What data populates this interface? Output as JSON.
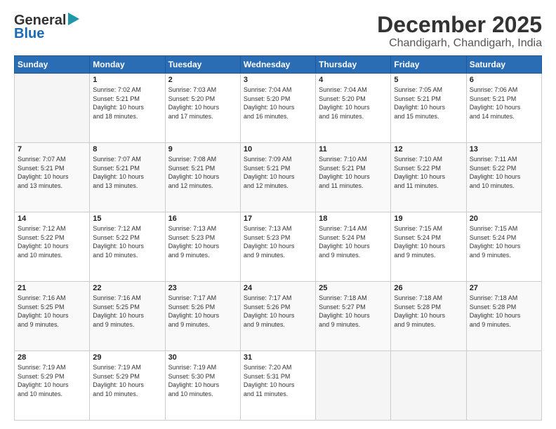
{
  "logo": {
    "general": "General",
    "blue": "Blue"
  },
  "header": {
    "month": "December 2025",
    "location": "Chandigarh, Chandigarh, India"
  },
  "weekdays": [
    "Sunday",
    "Monday",
    "Tuesday",
    "Wednesday",
    "Thursday",
    "Friday",
    "Saturday"
  ],
  "weeks": [
    [
      {
        "day": "",
        "info": ""
      },
      {
        "day": "1",
        "info": "Sunrise: 7:02 AM\nSunset: 5:21 PM\nDaylight: 10 hours\nand 18 minutes."
      },
      {
        "day": "2",
        "info": "Sunrise: 7:03 AM\nSunset: 5:20 PM\nDaylight: 10 hours\nand 17 minutes."
      },
      {
        "day": "3",
        "info": "Sunrise: 7:04 AM\nSunset: 5:20 PM\nDaylight: 10 hours\nand 16 minutes."
      },
      {
        "day": "4",
        "info": "Sunrise: 7:04 AM\nSunset: 5:20 PM\nDaylight: 10 hours\nand 16 minutes."
      },
      {
        "day": "5",
        "info": "Sunrise: 7:05 AM\nSunset: 5:21 PM\nDaylight: 10 hours\nand 15 minutes."
      },
      {
        "day": "6",
        "info": "Sunrise: 7:06 AM\nSunset: 5:21 PM\nDaylight: 10 hours\nand 14 minutes."
      }
    ],
    [
      {
        "day": "7",
        "info": "Sunrise: 7:07 AM\nSunset: 5:21 PM\nDaylight: 10 hours\nand 13 minutes."
      },
      {
        "day": "8",
        "info": "Sunrise: 7:07 AM\nSunset: 5:21 PM\nDaylight: 10 hours\nand 13 minutes."
      },
      {
        "day": "9",
        "info": "Sunrise: 7:08 AM\nSunset: 5:21 PM\nDaylight: 10 hours\nand 12 minutes."
      },
      {
        "day": "10",
        "info": "Sunrise: 7:09 AM\nSunset: 5:21 PM\nDaylight: 10 hours\nand 12 minutes."
      },
      {
        "day": "11",
        "info": "Sunrise: 7:10 AM\nSunset: 5:21 PM\nDaylight: 10 hours\nand 11 minutes."
      },
      {
        "day": "12",
        "info": "Sunrise: 7:10 AM\nSunset: 5:22 PM\nDaylight: 10 hours\nand 11 minutes."
      },
      {
        "day": "13",
        "info": "Sunrise: 7:11 AM\nSunset: 5:22 PM\nDaylight: 10 hours\nand 10 minutes."
      }
    ],
    [
      {
        "day": "14",
        "info": "Sunrise: 7:12 AM\nSunset: 5:22 PM\nDaylight: 10 hours\nand 10 minutes."
      },
      {
        "day": "15",
        "info": "Sunrise: 7:12 AM\nSunset: 5:22 PM\nDaylight: 10 hours\nand 10 minutes."
      },
      {
        "day": "16",
        "info": "Sunrise: 7:13 AM\nSunset: 5:23 PM\nDaylight: 10 hours\nand 9 minutes."
      },
      {
        "day": "17",
        "info": "Sunrise: 7:13 AM\nSunset: 5:23 PM\nDaylight: 10 hours\nand 9 minutes."
      },
      {
        "day": "18",
        "info": "Sunrise: 7:14 AM\nSunset: 5:24 PM\nDaylight: 10 hours\nand 9 minutes."
      },
      {
        "day": "19",
        "info": "Sunrise: 7:15 AM\nSunset: 5:24 PM\nDaylight: 10 hours\nand 9 minutes."
      },
      {
        "day": "20",
        "info": "Sunrise: 7:15 AM\nSunset: 5:24 PM\nDaylight: 10 hours\nand 9 minutes."
      }
    ],
    [
      {
        "day": "21",
        "info": "Sunrise: 7:16 AM\nSunset: 5:25 PM\nDaylight: 10 hours\nand 9 minutes."
      },
      {
        "day": "22",
        "info": "Sunrise: 7:16 AM\nSunset: 5:25 PM\nDaylight: 10 hours\nand 9 minutes."
      },
      {
        "day": "23",
        "info": "Sunrise: 7:17 AM\nSunset: 5:26 PM\nDaylight: 10 hours\nand 9 minutes."
      },
      {
        "day": "24",
        "info": "Sunrise: 7:17 AM\nSunset: 5:26 PM\nDaylight: 10 hours\nand 9 minutes."
      },
      {
        "day": "25",
        "info": "Sunrise: 7:18 AM\nSunset: 5:27 PM\nDaylight: 10 hours\nand 9 minutes."
      },
      {
        "day": "26",
        "info": "Sunrise: 7:18 AM\nSunset: 5:28 PM\nDaylight: 10 hours\nand 9 minutes."
      },
      {
        "day": "27",
        "info": "Sunrise: 7:18 AM\nSunset: 5:28 PM\nDaylight: 10 hours\nand 9 minutes."
      }
    ],
    [
      {
        "day": "28",
        "info": "Sunrise: 7:19 AM\nSunset: 5:29 PM\nDaylight: 10 hours\nand 10 minutes."
      },
      {
        "day": "29",
        "info": "Sunrise: 7:19 AM\nSunset: 5:29 PM\nDaylight: 10 hours\nand 10 minutes."
      },
      {
        "day": "30",
        "info": "Sunrise: 7:19 AM\nSunset: 5:30 PM\nDaylight: 10 hours\nand 10 minutes."
      },
      {
        "day": "31",
        "info": "Sunrise: 7:20 AM\nSunset: 5:31 PM\nDaylight: 10 hours\nand 11 minutes."
      },
      {
        "day": "",
        "info": ""
      },
      {
        "day": "",
        "info": ""
      },
      {
        "day": "",
        "info": ""
      }
    ]
  ]
}
